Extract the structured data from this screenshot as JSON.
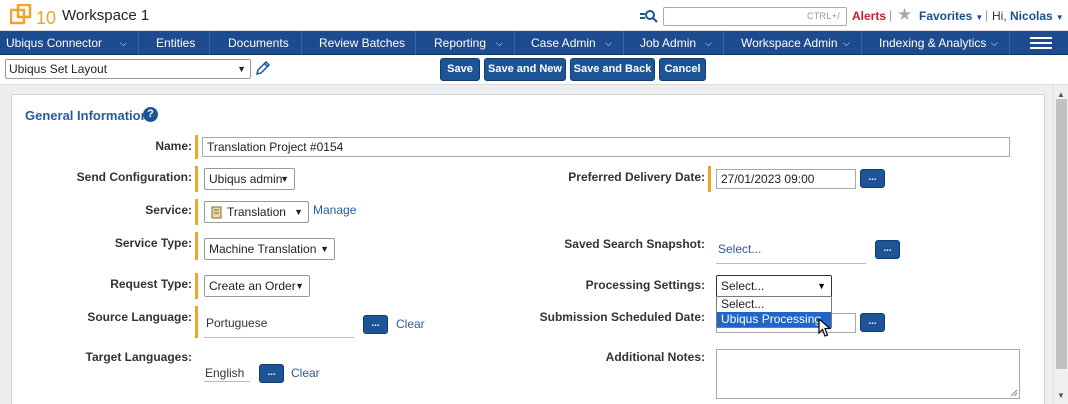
{
  "header": {
    "logo_text": "10",
    "workspace_title": "Workspace 1",
    "search_hint": "CTRL+/",
    "alerts_label": "Alerts",
    "favorites_label": "Favorites",
    "greeting": "Hi,",
    "user_name": "Nicolas"
  },
  "nav": {
    "items": [
      {
        "label": "Ubiqus Connector",
        "has_menu": true
      },
      {
        "label": "Entities",
        "has_menu": false
      },
      {
        "label": "Documents",
        "has_menu": false
      },
      {
        "label": "Review Batches",
        "has_menu": false
      },
      {
        "label": "Reporting",
        "has_menu": true
      },
      {
        "label": "Case Admin",
        "has_menu": true
      },
      {
        "label": "Job Admin",
        "has_menu": true
      },
      {
        "label": "Workspace Admin",
        "has_menu": true
      },
      {
        "label": "Indexing & Analytics",
        "has_menu": true
      }
    ]
  },
  "toolbar": {
    "layout_value": "Ubiqus Set Layout",
    "save_label": "Save",
    "save_new_label": "Save and New",
    "save_back_label": "Save and Back",
    "cancel_label": "Cancel"
  },
  "form": {
    "section_title": "General Information",
    "help_symbol": "?",
    "name_label": "Name:",
    "name_value": "Translation Project #0154",
    "send_config_label": "Send Configuration:",
    "send_config_value": "Ubiqus admin",
    "service_label": "Service:",
    "service_value": "Translation",
    "manage_link": "Manage",
    "service_type_label": "Service Type:",
    "service_type_value": "Machine Translation",
    "request_type_label": "Request Type:",
    "request_type_value": "Create an Order",
    "source_lang_label": "Source Language:",
    "source_lang_value": "Portuguese",
    "target_lang_label": "Target Languages:",
    "target_lang_value": "English",
    "clear_label": "Clear",
    "ellipsis": "...",
    "delivery_label": "Preferred Delivery Date:",
    "delivery_value": "27/01/2023 09:00",
    "saved_search_label": "Saved Search Snapshot:",
    "saved_search_value": "Select...",
    "processing_label": "Processing Settings:",
    "processing_value": "Select...",
    "processing_options": [
      "Select...",
      "Ubiqus Processing"
    ],
    "submission_label": "Submission Scheduled Date:",
    "notes_label": "Additional Notes:"
  },
  "colors": {
    "nav_bg": "#1d4b8f",
    "button_bg": "#1d5496",
    "required_marker": "#f2a32a",
    "alerts": "#c0212b",
    "link": "#2a5b97",
    "option_highlight": "#1e66c8"
  }
}
